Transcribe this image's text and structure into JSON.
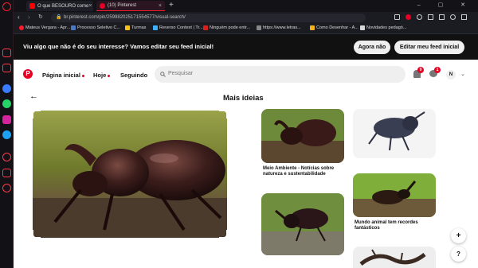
{
  "browser": {
    "tabs": [
      {
        "label": "O que BESOURO come"
      },
      {
        "label": "(10) Pinterest"
      }
    ],
    "url": "br.pinterest.com/pin/259982025171554577/visual-search/",
    "bookmarks": [
      {
        "label": "Mateus Vergara - Apr..."
      },
      {
        "label": "Processo Seletivo C..."
      },
      {
        "label": "Turmas"
      },
      {
        "label": "Reverso Context | Tr..."
      },
      {
        "label": "Ninguém pode entr..."
      },
      {
        "label": "https://www.letras..."
      },
      {
        "label": "Como Desenhar - A..."
      },
      {
        "label": "Novidades pedagó..."
      }
    ]
  },
  "banner": {
    "text": "Viu algo que não é do seu interesse? Vamos editar seu feed inicial!",
    "later_label": "Agora não",
    "edit_label": "Editar meu feed inicial"
  },
  "header": {
    "home_label": "Página inicial",
    "today_label": "Hoje",
    "following_label": "Seguindo",
    "search_placeholder": "Pesquisar",
    "notifications_count": "9",
    "messages_count": "1",
    "avatar_initial": "N"
  },
  "main": {
    "title": "Mais ideias"
  },
  "pins": [
    {
      "caption": "Meio Ambiente - Notícias sobre natureza e sustentabilidade"
    },
    {
      "caption": ""
    },
    {
      "caption": "Mundo animal tem recordes fantásticos"
    },
    {
      "caption": ""
    },
    {
      "caption": ""
    }
  ],
  "fab": {
    "add": "+",
    "help": "?"
  },
  "colors": {
    "brand": "#e60023",
    "opera_red": "#ff1b2d"
  }
}
